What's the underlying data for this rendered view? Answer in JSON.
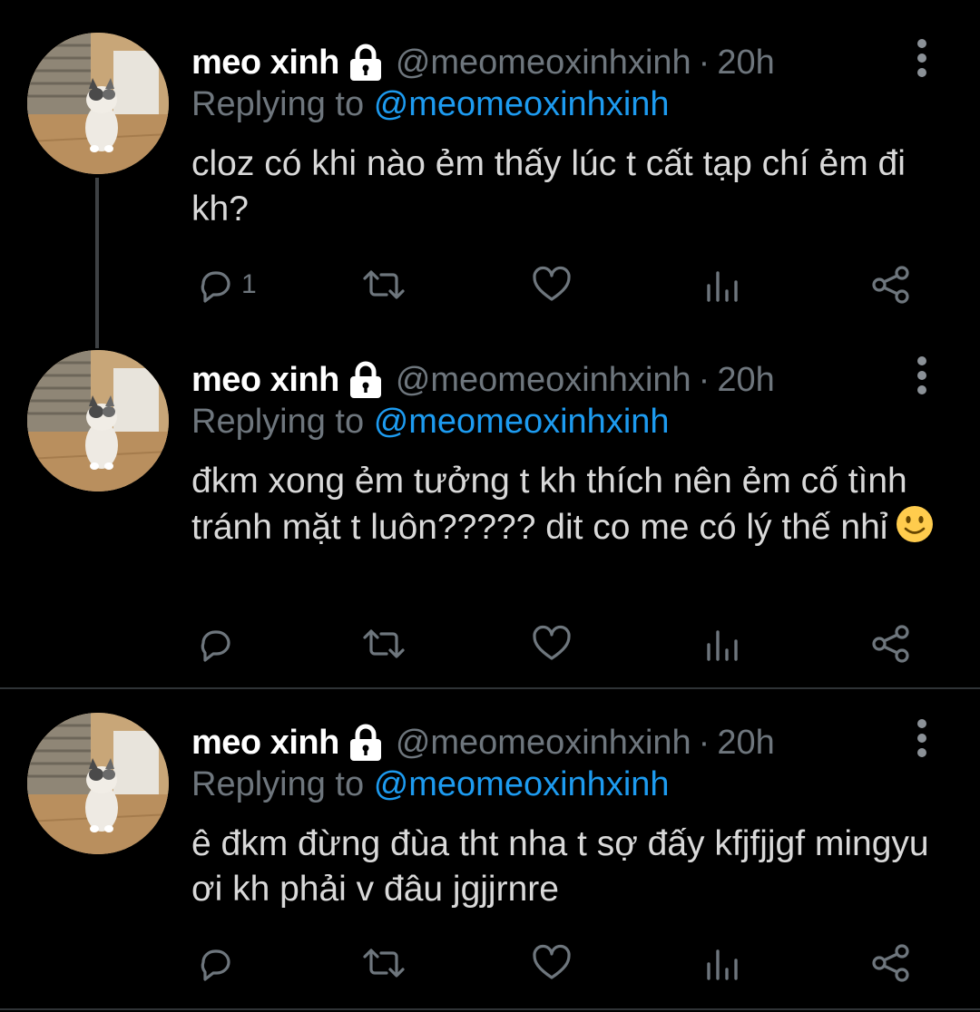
{
  "tweets": [
    {
      "display_name": "meo xinh",
      "handle": "@meomeoxinhxinh",
      "separator": "·",
      "time": "20h",
      "replying_label": "Replying to",
      "replying_handle": "@meomeoxinhxinh",
      "text": "cloz có khi nào ẻm thấy lúc t cất tạp chí ẻm đi kh?",
      "reply_count": "1",
      "has_emoji": false
    },
    {
      "display_name": "meo xinh",
      "handle": "@meomeoxinhxinh",
      "separator": "·",
      "time": "20h",
      "replying_label": "Replying to",
      "replying_handle": "@meomeoxinhxinh",
      "text": "đkm xong ẻm tưởng t kh thích nên ẻm cố tình tránh mặt t luôn????? dit co me có lý thế nhỉ",
      "reply_count": "",
      "has_emoji": true
    },
    {
      "display_name": "meo xinh",
      "handle": "@meomeoxinhxinh",
      "separator": "·",
      "time": "20h",
      "replying_label": "Replying to",
      "replying_handle": "@meomeoxinhxinh",
      "text": "ê đkm đừng đùa tht nha t sợ đấy kfjfjjgf mingyu ơi kh phải v đâu jgjjrnre",
      "reply_count": "",
      "has_emoji": false
    }
  ],
  "icons": {
    "lock": "lock-icon",
    "more": "more-vertical-icon",
    "reply": "reply-icon",
    "retweet": "retweet-icon",
    "like": "heart-icon",
    "analytics": "analytics-icon",
    "share": "share-icon",
    "emoji": "slightly-smiling-face-emoji"
  },
  "colors": {
    "background": "#000000",
    "name": "#ffffff",
    "muted": "#6e767d",
    "link": "#1d9bf0",
    "text": "#d9d9d9",
    "divider": "#2f3336"
  }
}
